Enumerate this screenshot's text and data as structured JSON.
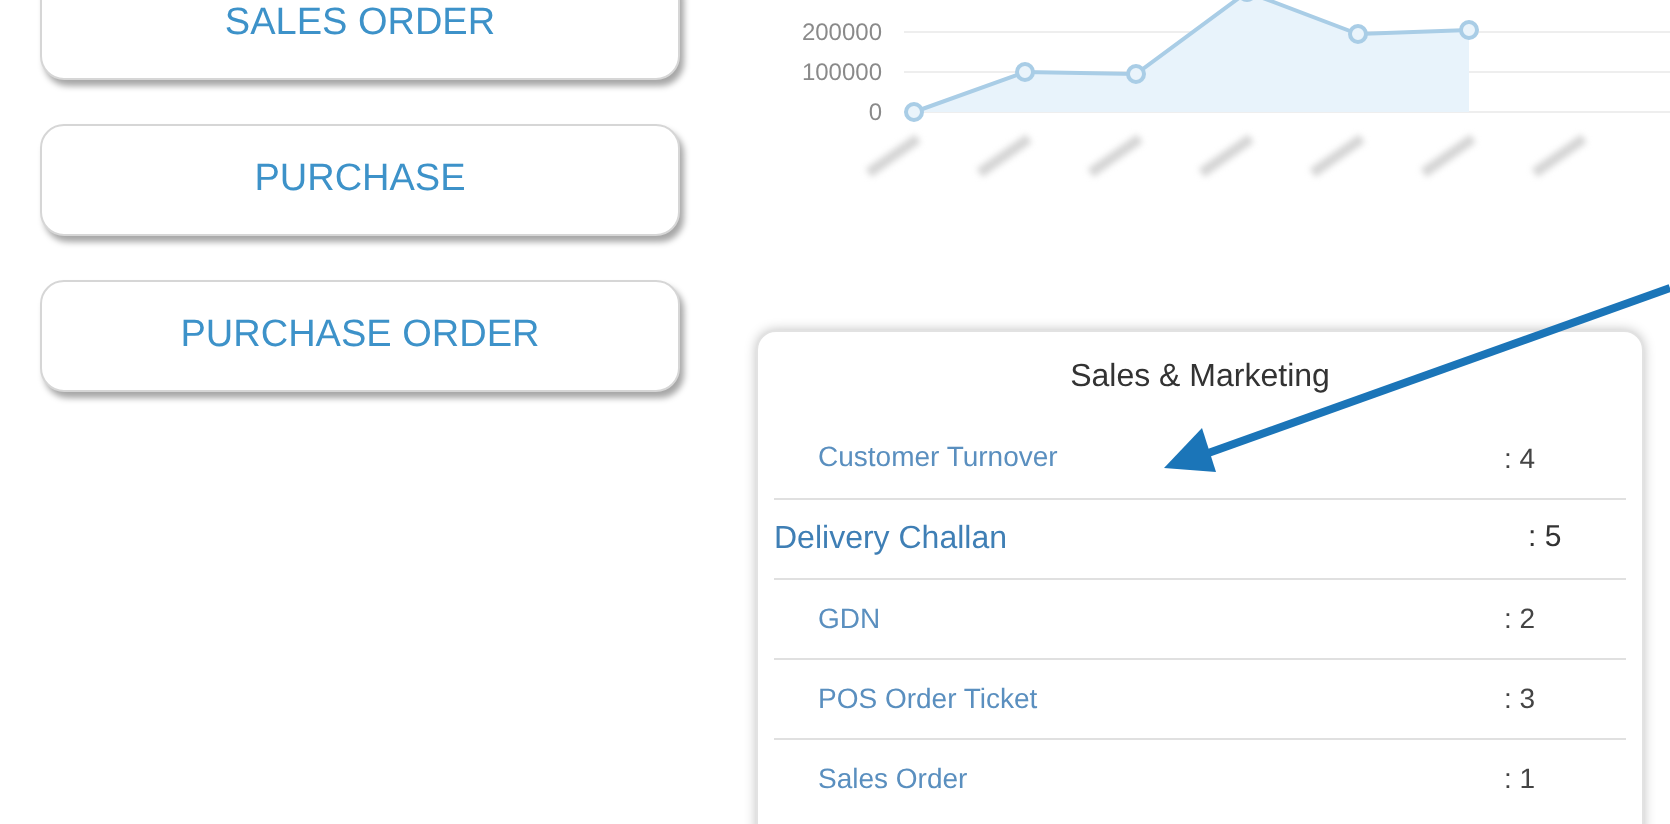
{
  "menu_buttons": [
    {
      "label": "SALES ORDER"
    },
    {
      "label": "PURCHASE"
    },
    {
      "label": "PURCHASE ORDER"
    }
  ],
  "chart": {
    "y_labels": [
      "200000",
      "100000",
      "0"
    ]
  },
  "panel": {
    "title": "Sales & Marketing",
    "rows": [
      {
        "label": "Customer Turnover",
        "count": ": 4",
        "kind": "sub"
      },
      {
        "label": "Delivery Challan",
        "count": ": 5",
        "kind": "group"
      },
      {
        "label": "GDN",
        "count": ": 2",
        "kind": "sub"
      },
      {
        "label": "POS Order Ticket",
        "count": ": 3",
        "kind": "sub"
      },
      {
        "label": "Sales Order",
        "count": ": 1",
        "kind": "sub"
      }
    ]
  }
}
